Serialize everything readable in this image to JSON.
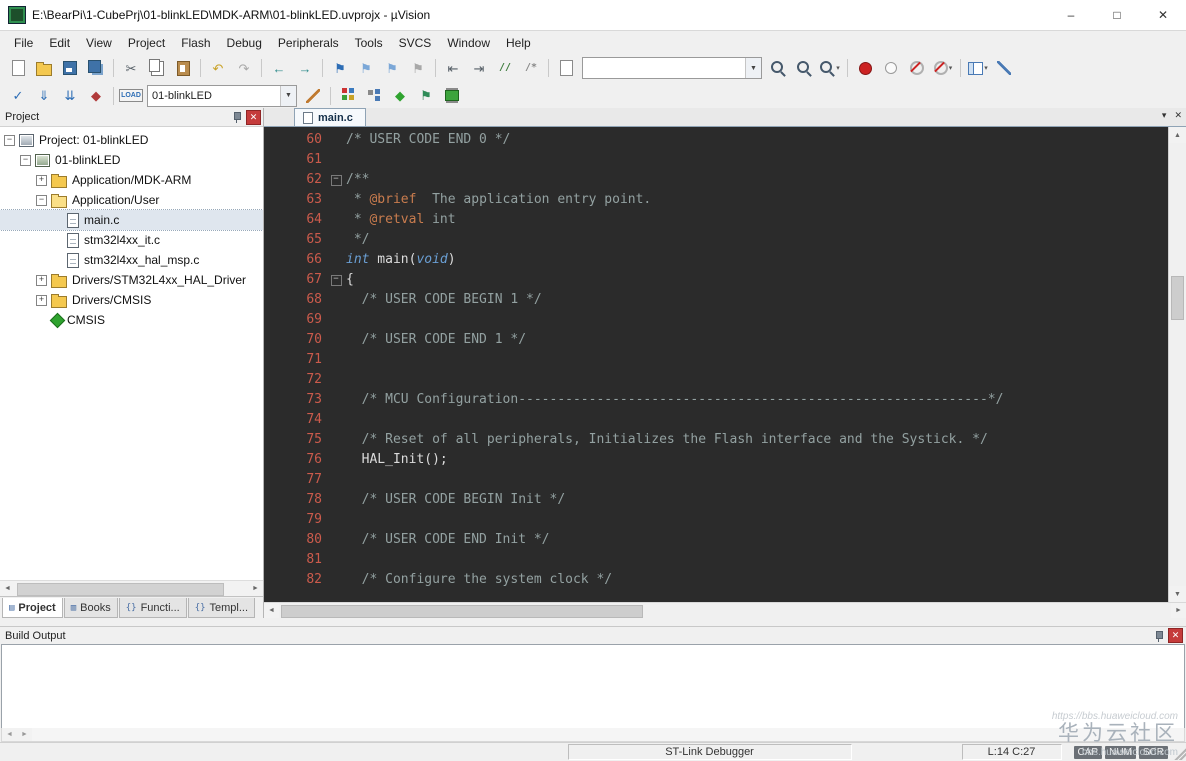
{
  "window": {
    "title": "E:\\BearPi\\1-CubePrj\\01-blinkLED\\MDK-ARM\\01-blinkLED.uvprojx - µVision"
  },
  "icons": {
    "minimize": "–",
    "maximize": "□",
    "close": "✕",
    "chevron_down": "▾",
    "arrow_left": "◄",
    "arrow_right": "►",
    "arrow_up": "▲",
    "arrow_down": "▼"
  },
  "menu": {
    "items": [
      "File",
      "Edit",
      "View",
      "Project",
      "Flash",
      "Debug",
      "Peripherals",
      "Tools",
      "SVCS",
      "Window",
      "Help"
    ]
  },
  "toolbar_main": {
    "items": [
      {
        "name": "new-file-button",
        "kind": "page"
      },
      {
        "name": "open-file-button",
        "kind": "folder"
      },
      {
        "name": "save-button",
        "kind": "floppy"
      },
      {
        "name": "save-all-button",
        "kind": "floppy-all"
      },
      {
        "kind": "sep"
      },
      {
        "name": "cut-button",
        "kind": "glyph",
        "glyph": "✂",
        "color": "#555e66"
      },
      {
        "name": "copy-button",
        "kind": "copy"
      },
      {
        "name": "paste-button",
        "kind": "paste"
      },
      {
        "kind": "sep"
      },
      {
        "name": "undo-button",
        "kind": "glyph",
        "glyph": "↶",
        "color": "#c9a227"
      },
      {
        "name": "redo-button",
        "kind": "glyph",
        "glyph": "↷",
        "color": "#a8a8a8"
      },
      {
        "kind": "sep"
      },
      {
        "name": "navigate-back-button",
        "kind": "glyph",
        "glyph": "←",
        "color": "#2e8b8b"
      },
      {
        "name": "navigate-forward-button",
        "kind": "glyph",
        "glyph": "→",
        "color": "#2e8b8b"
      },
      {
        "kind": "sep"
      },
      {
        "name": "toggle-bookmark-button",
        "kind": "glyph",
        "glyph": "⚑",
        "color": "#2d6db5"
      },
      {
        "name": "previous-bookmark-button",
        "kind": "glyph",
        "glyph": "⚑",
        "color": "#7ba7d7"
      },
      {
        "name": "next-bookmark-button",
        "kind": "glyph",
        "glyph": "⚑",
        "color": "#7ba7d7"
      },
      {
        "name": "clear-bookmarks-button",
        "kind": "glyph",
        "glyph": "⚑",
        "color": "#a8a8a8"
      },
      {
        "kind": "sep"
      },
      {
        "name": "unindent-button",
        "kind": "glyph",
        "glyph": "⇤",
        "color": "#555e66"
      },
      {
        "name": "indent-button",
        "kind": "glyph",
        "glyph": "⇥",
        "color": "#555e66"
      },
      {
        "name": "comment-button",
        "kind": "glyph-sm",
        "glyph": "//",
        "color": "#3a7a3a"
      },
      {
        "name": "uncomment-button",
        "kind": "glyph-sm",
        "glyph": "/*",
        "color": "#888888"
      },
      {
        "kind": "sep"
      },
      {
        "name": "find-in-files-button",
        "kind": "page"
      },
      {
        "name": "find-text-combo",
        "kind": "combo",
        "value": "",
        "combo_class": "combo-find"
      },
      {
        "name": "find-next-button",
        "kind": "magnifier"
      },
      {
        "name": "incremental-find-button",
        "kind": "magnifier"
      },
      {
        "name": "find-button",
        "kind": "magnifier",
        "dropdown": true
      },
      {
        "kind": "sep"
      },
      {
        "name": "insert-breakpoint-button",
        "kind": "circle",
        "color": "#cc2222"
      },
      {
        "name": "disable-breakpoint-button",
        "kind": "circle-o"
      },
      {
        "name": "kill-breakpoints-button",
        "kind": "circle-slash"
      },
      {
        "name": "breakpoint-options-button",
        "kind": "circle-slash",
        "dropdown": true
      },
      {
        "kind": "sep"
      },
      {
        "name": "window-layout-button",
        "kind": "grid",
        "dropdown": true
      },
      {
        "name": "configure-button",
        "kind": "wrench"
      }
    ]
  },
  "toolbar_build": {
    "items": [
      {
        "name": "translate-file-button",
        "kind": "glyph",
        "glyph": "✓",
        "color": "#2d6db5"
      },
      {
        "name": "build-button",
        "kind": "glyph",
        "glyph": "⇓",
        "color": "#2d6db5"
      },
      {
        "name": "rebuild-button",
        "kind": "glyph",
        "glyph": "⇊",
        "color": "#2d6db5"
      },
      {
        "name": "batch-build-button",
        "kind": "glyph",
        "glyph": "◆",
        "color": "#b03a3a"
      },
      {
        "kind": "sep"
      },
      {
        "name": "download-button",
        "kind": "load",
        "glyph": "LOAD"
      },
      {
        "name": "target-select",
        "kind": "combo",
        "value": "01-blinkLED",
        "combo_class": "combo-target"
      },
      {
        "name": "target-options-button",
        "kind": "wand"
      },
      {
        "kind": "sep"
      },
      {
        "name": "manage-components-button",
        "kind": "blocks"
      },
      {
        "name": "file-extensions-button",
        "kind": "tree"
      },
      {
        "name": "runtime-environment-button",
        "kind": "glyph",
        "glyph": "◆",
        "color": "#2fa32f"
      },
      {
        "name": "batch-setup-button",
        "kind": "glyph",
        "glyph": "⚑",
        "color": "#2e8b57"
      },
      {
        "name": "pack-installer-button",
        "kind": "chip"
      }
    ]
  },
  "project_panel": {
    "title": "Project",
    "tree": [
      {
        "label": "Project: 01-blinkLED",
        "icon": "target",
        "level": 0,
        "expand": "minus"
      },
      {
        "label": "01-blinkLED",
        "icon": "target2",
        "level": 1,
        "expand": "minus"
      },
      {
        "label": "Application/MDK-ARM",
        "icon": "folder",
        "level": 2,
        "expand": "plus"
      },
      {
        "label": "Application/User",
        "icon": "folder-open",
        "level": 2,
        "expand": "minus"
      },
      {
        "label": "main.c",
        "icon": "file",
        "level": 3,
        "selected": true
      },
      {
        "label": "stm32l4xx_it.c",
        "icon": "file",
        "level": 3
      },
      {
        "label": "stm32l4xx_hal_msp.c",
        "icon": "file",
        "level": 3
      },
      {
        "label": "Drivers/STM32L4xx_HAL_Driver",
        "icon": "folder",
        "level": 2,
        "expand": "plus"
      },
      {
        "label": "Drivers/CMSIS",
        "icon": "folder",
        "level": 2,
        "expand": "plus"
      },
      {
        "label": "CMSIS",
        "icon": "cmsis",
        "level": 2
      }
    ],
    "tabs": [
      {
        "label": "Project",
        "icon": "project",
        "glyph": "▤",
        "selected": true
      },
      {
        "label": "Books",
        "icon": "books",
        "glyph": "▥"
      },
      {
        "label": "Functi...",
        "icon": "functions",
        "glyph": "{}"
      },
      {
        "label": "Templ...",
        "icon": "templates",
        "glyph": "{}"
      }
    ]
  },
  "editor": {
    "tabs": [
      {
        "label": "main.c",
        "selected": true
      }
    ],
    "colors": {
      "background": "#2b2b2b",
      "line_number": "#cb5b4c",
      "comment": "#93a1a1",
      "doctag": "#c97c4e",
      "keyword": "#6a9fd4",
      "plain": "#dcdcdc"
    },
    "code": {
      "lines": [
        {
          "n": 60,
          "tokens": [
            [
              "c",
              "/* USER CODE END 0 */"
            ]
          ]
        },
        {
          "n": 61,
          "tokens": []
        },
        {
          "n": 62,
          "fold": true,
          "tokens": [
            [
              "c",
              "/**"
            ]
          ]
        },
        {
          "n": 63,
          "tokens": [
            [
              "c",
              " * "
            ],
            [
              "d",
              "@brief"
            ],
            [
              "c",
              "  The application entry point."
            ]
          ]
        },
        {
          "n": 64,
          "tokens": [
            [
              "c",
              " * "
            ],
            [
              "d",
              "@retval"
            ],
            [
              "c",
              " int"
            ]
          ]
        },
        {
          "n": 65,
          "tokens": [
            [
              "c",
              " */"
            ]
          ]
        },
        {
          "n": 66,
          "tokens": [
            [
              "k",
              "int"
            ],
            [
              "p",
              " main("
            ],
            [
              "k",
              "void"
            ],
            [
              "p",
              ")"
            ]
          ]
        },
        {
          "n": 67,
          "fold": true,
          "tokens": [
            [
              "p",
              "{"
            ]
          ]
        },
        {
          "n": 68,
          "tokens": [
            [
              "p",
              "  "
            ],
            [
              "c",
              "/* USER CODE BEGIN 1 */"
            ]
          ]
        },
        {
          "n": 69,
          "tokens": []
        },
        {
          "n": 70,
          "tokens": [
            [
              "p",
              "  "
            ],
            [
              "c",
              "/* USER CODE END 1 */"
            ]
          ]
        },
        {
          "n": 71,
          "tokens": []
        },
        {
          "n": 72,
          "tokens": []
        },
        {
          "n": 73,
          "tokens": [
            [
              "p",
              "  "
            ],
            [
              "c",
              "/* MCU Configuration------------------------------------------------------------*/"
            ]
          ]
        },
        {
          "n": 74,
          "tokens": []
        },
        {
          "n": 75,
          "tokens": [
            [
              "p",
              "  "
            ],
            [
              "c",
              "/* Reset of all peripherals, Initializes the Flash interface and the Systick. */"
            ]
          ]
        },
        {
          "n": 76,
          "tokens": [
            [
              "p",
              "  HAL_Init();"
            ]
          ]
        },
        {
          "n": 77,
          "tokens": []
        },
        {
          "n": 78,
          "tokens": [
            [
              "p",
              "  "
            ],
            [
              "c",
              "/* USER CODE BEGIN Init */"
            ]
          ]
        },
        {
          "n": 79,
          "tokens": []
        },
        {
          "n": 80,
          "tokens": [
            [
              "p",
              "  "
            ],
            [
              "c",
              "/* USER CODE END Init */"
            ]
          ]
        },
        {
          "n": 81,
          "tokens": []
        },
        {
          "n": 82,
          "tokens": [
            [
              "p",
              "  "
            ],
            [
              "c",
              "/* Configure the system clock */"
            ]
          ]
        }
      ]
    }
  },
  "build_output": {
    "title": "Build Output",
    "content": ""
  },
  "status_bar": {
    "debugger": "ST-Link Debugger",
    "position": "L:14 C:27",
    "indicators": [
      "CAP",
      "NUM",
      "SCR"
    ]
  },
  "watermark": {
    "url_faint": "https://bbs.huaweicloud.com",
    "brand": "华为云社区",
    "url": "bbs.huaweicloud.com"
  }
}
